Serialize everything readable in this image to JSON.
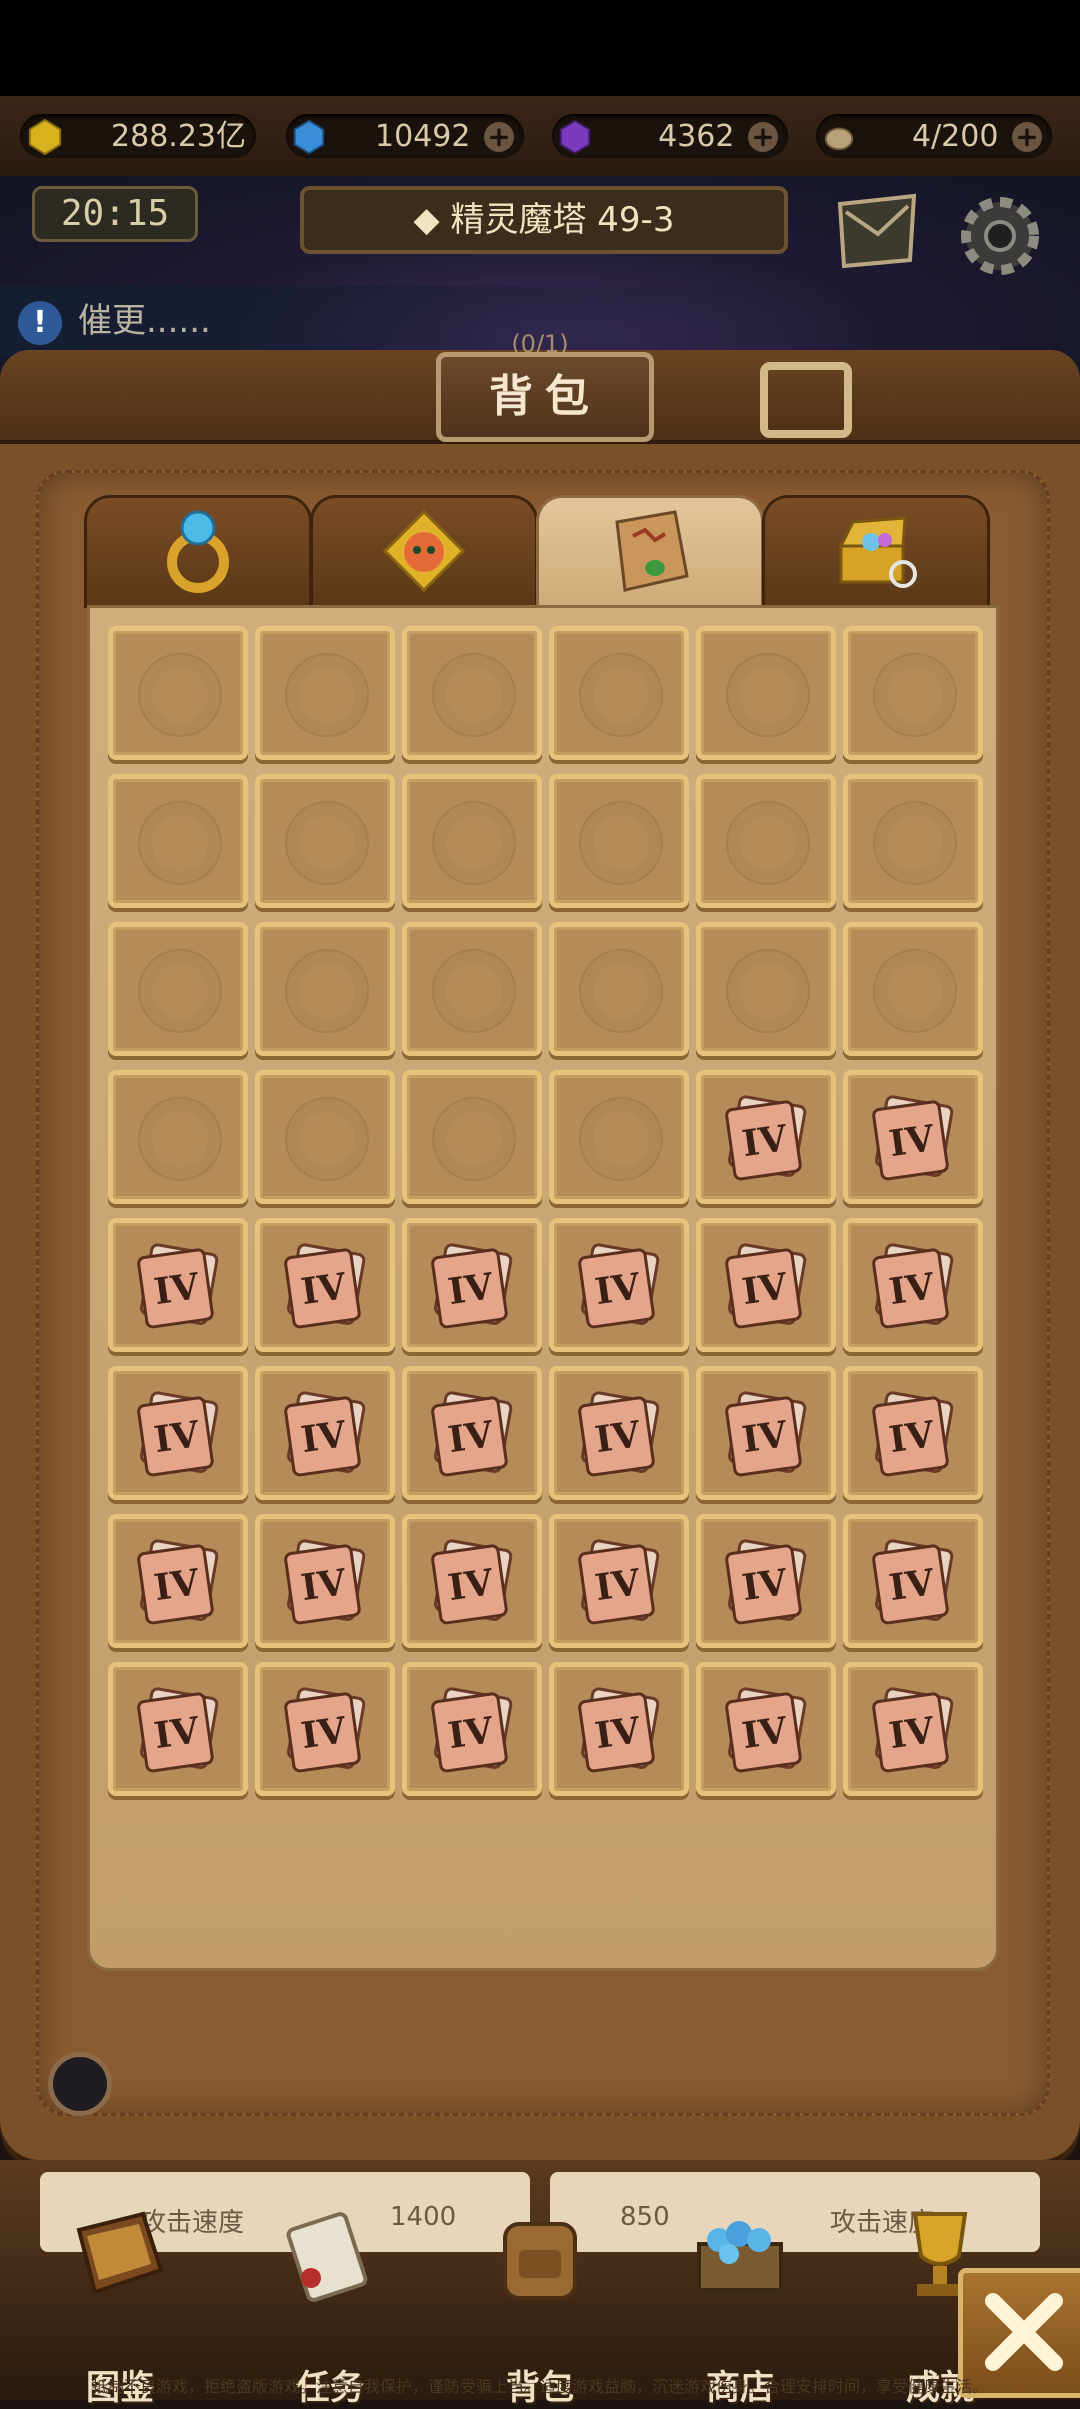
{
  "header": {
    "resources": [
      {
        "name": "gold",
        "value": "288.23亿",
        "color": "#d8b61e",
        "has_plus": false
      },
      {
        "name": "diamond",
        "value": "10492",
        "color": "#3a8ed8",
        "has_plus": true
      },
      {
        "name": "purple-gem",
        "value": "4362",
        "color": "#7a3bbf",
        "has_plus": true
      },
      {
        "name": "stamina",
        "value": "4/200",
        "color": "#b7a07a",
        "has_plus": true
      }
    ],
    "timer": "20:15",
    "stage_title": "精灵魔塔 49-3",
    "notice_text": "催更......"
  },
  "bag": {
    "title": "背包",
    "count_text": "(0/1)",
    "tabs": [
      {
        "name": "equipment",
        "icon": "ring-icon",
        "active": false
      },
      {
        "name": "fragments",
        "icon": "puzzle-pet-icon",
        "active": false
      },
      {
        "name": "maps",
        "icon": "map-icon",
        "active": true
      },
      {
        "name": "treasure",
        "icon": "treasure-chest-icon",
        "active": false
      }
    ],
    "grid": {
      "columns": 6,
      "rows": 8,
      "item_label": "IV",
      "empty_slots": 22,
      "filled_slots": 26
    }
  },
  "bottom_stats": {
    "left": {
      "label": "攻击速度",
      "value": "1400"
    },
    "right": {
      "label": "攻击速度",
      "value": "850"
    }
  },
  "nav": [
    {
      "label": "图鉴",
      "icon": "book-icon"
    },
    {
      "label": "任务",
      "icon": "scroll-icon"
    },
    {
      "label": "背包",
      "icon": "backpack-icon"
    },
    {
      "label": "商店",
      "icon": "gem-chest-icon"
    },
    {
      "label": "成就",
      "icon": "trophy-icon"
    }
  ],
  "footer_note": "抵制不良游戏，拒绝盗版游戏。注意自我保护，谨防受骗上当。适度游戏益脑，沉迷游戏伤身。合理安排时间，享受健康生活。"
}
